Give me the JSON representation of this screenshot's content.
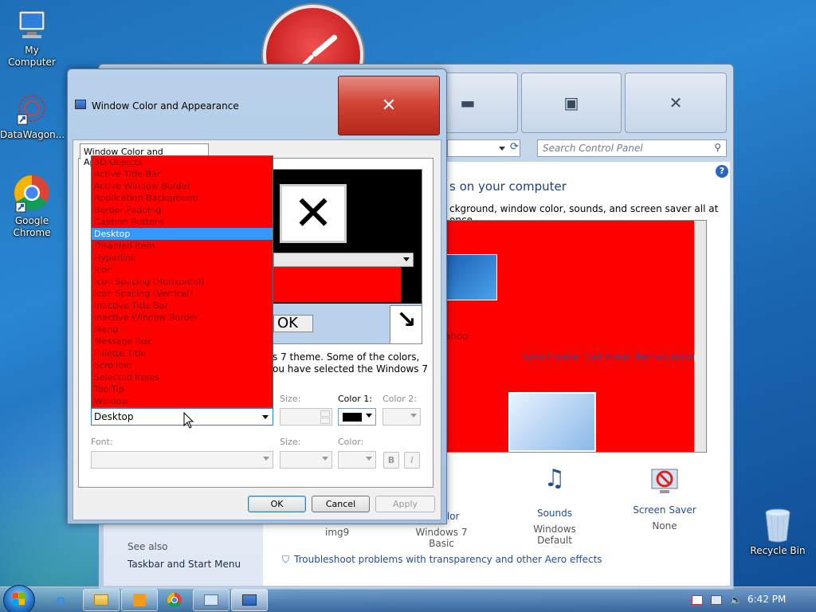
{
  "desktop": {
    "icons": [
      {
        "label": "My Computer"
      },
      {
        "label": "DataWagon..."
      },
      {
        "label": "Google Chrome"
      },
      {
        "label": "Recycle Bin"
      }
    ]
  },
  "control_panel": {
    "search_placeholder": "Search Control Panel",
    "heading": "s on your computer",
    "description": "ckground, window color, sounds, and screen saver all at once.",
    "theme_link_save": "Save theme",
    "theme_link_more": "Get more themes online",
    "theme_caption": "ahoo",
    "see_also": "See also",
    "taskbar_link": "Taskbar and Start Menu",
    "aero_link": "Troubleshoot problems with transparency and other Aero effects",
    "bottom_items": [
      {
        "title": "",
        "subtitle": "img9"
      },
      {
        "title": "w Color",
        "subtitle": "Windows 7 Basic"
      },
      {
        "title": "Sounds",
        "subtitle": "Windows Default"
      },
      {
        "title": "Screen Saver",
        "subtitle": "None"
      }
    ]
  },
  "dialog": {
    "title": "Window Color and Appearance",
    "tab_label": "Window Color and Appearance",
    "theme_text_line1": "s 7 theme.  Some of the colors,",
    "theme_text_line2": "ou have selected the Windows 7",
    "item_selected": "Desktop",
    "item_options": [
      "3D Objects",
      "Active Title Bar",
      "Active Window Border",
      "Application Background",
      "Border Padding",
      "Caption Buttons",
      "Desktop",
      "Disabled Item",
      "Hyperlink",
      "Icon",
      "Icon Spacing (Horizontal)",
      "Icon Spacing (Vertical)",
      "Inactive Title Bar",
      "Inactive Window Border",
      "Menu",
      "Message Box",
      "Palette Title",
      "Scrollbar",
      "Selected Items",
      "ToolTip",
      "Window"
    ],
    "size_label": "Size:",
    "color1_label": "Color 1:",
    "color2_label": "Color 2:",
    "font_label": "Font:",
    "font_size_label": "Size:",
    "font_color_label": "Color:",
    "bold_label": "B",
    "italic_label": "I",
    "preview_ok": "OK",
    "ok_button": "OK",
    "cancel_button": "Cancel",
    "apply_button": "Apply",
    "close_glyph": "✕"
  },
  "taskbar": {
    "clock": "6:42 PM"
  },
  "colors": {
    "dropdown_bg": "#ff0000",
    "selection": "#3399ff",
    "close_button": "#c9362a"
  }
}
